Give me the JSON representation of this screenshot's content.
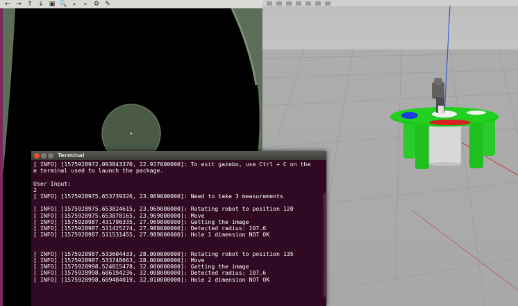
{
  "viewer": {
    "toolbar_icons": [
      "arrow-left-icon",
      "arrow-right-icon",
      "arrow-up-icon",
      "arrow-down-icon",
      "save-icon",
      "zoom-icon",
      "zoom-fit-icon",
      "zoom-reset-icon",
      "settings-icon",
      "brush-icon"
    ],
    "toolbar_glyphs": [
      "←",
      "→",
      "↑",
      "↓",
      "▣",
      "🔍",
      "⌕",
      "⌕",
      "⚙",
      "✎"
    ]
  },
  "terminal": {
    "title": "Terminal",
    "lines": [
      "[ INFO] [1575928972.093843370, 22.917000000]: To exit gazebo, use Ctrl + C on the",
      "e terminal used to launch the package.",
      "",
      "User Input:",
      "2",
      "[ INFO] [1575928975.653739326, 23.969000000]: Need to take 3 measurements",
      "",
      "[ INFO] [1575928975.653824615, 23.969000000]: Rotating robot to position 120",
      "[ INFO] [1575928975.653878165, 23.969000000]: Move",
      "[ INFO] [1575928987.431796335, 27.969000000]: Getting the image",
      "[ INFO] [1575928987.511425274, 27.988000000]: Detected radius: 107.6",
      "[ INFO] [1575928987.511531455, 27.989000000]: Hole 1 dimension NOT OK",
      "",
      "",
      "[ INFO] [1575928987.533604433, 28.000000000]: Rotating robot to position 135",
      "[ INFO] [1575928987.533748663, 28.000000000]: Move",
      "[ INFO] [1575928998.524815478, 32.000000000]: Getting the image",
      "[ INFO] [1575928998.606194236, 32.008000000]: Detected radius: 107.6",
      "[ INFO] [1575928998.609484019, 32.010000000]: Hole 2 dimension NOT OK"
    ]
  }
}
